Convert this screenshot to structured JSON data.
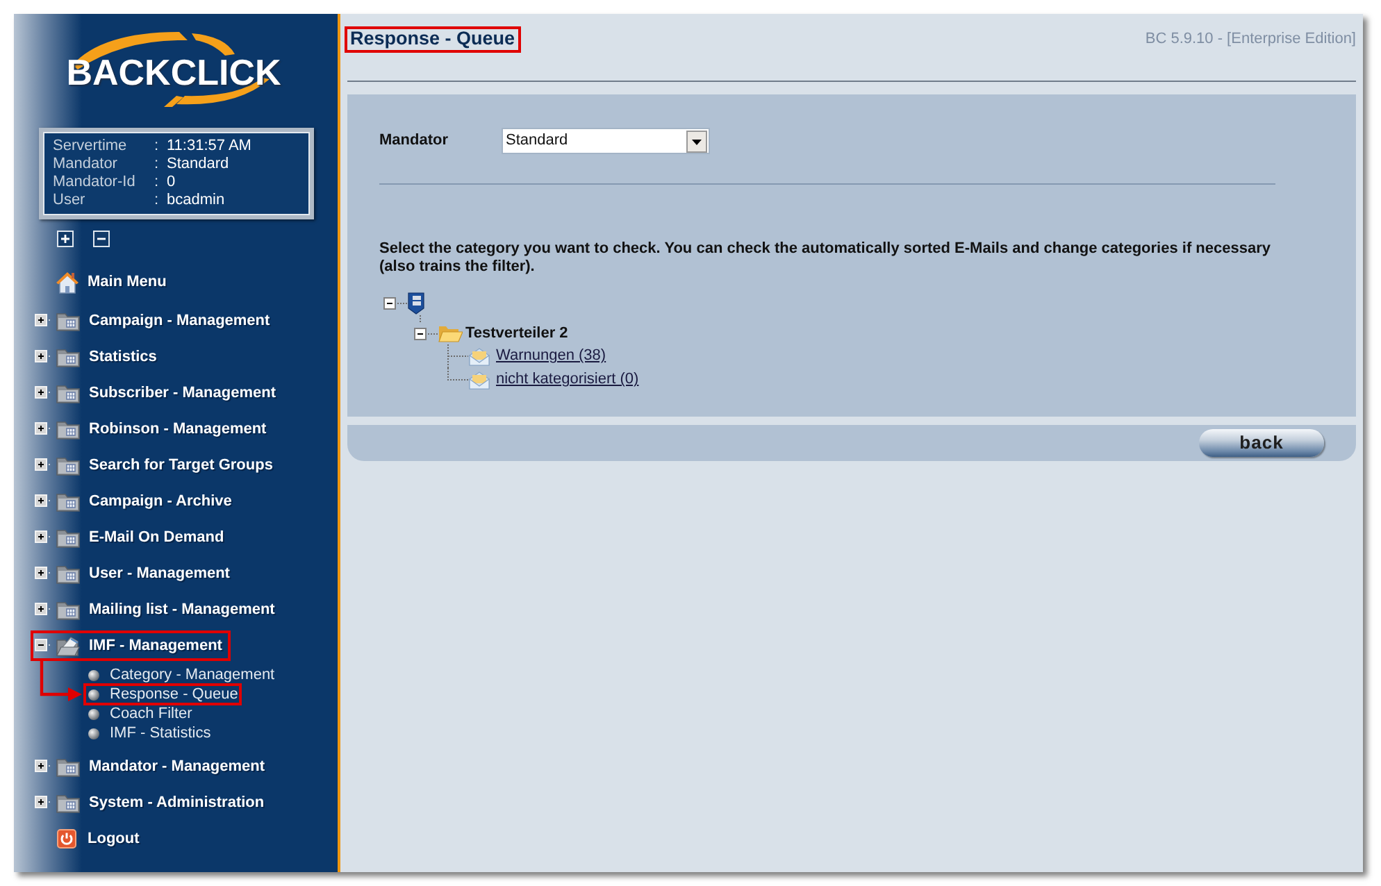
{
  "sidebar": {
    "logo": "BACKCLICK",
    "server_info": [
      {
        "label": "Servertime",
        "separator": ":",
        "value": "11:31:57 AM"
      },
      {
        "label": "Mandator",
        "separator": ":",
        "value": "Standard"
      },
      {
        "label": "Mandator-Id",
        "separator": ":",
        "value": "0"
      },
      {
        "label": "User",
        "separator": ":",
        "value": "bcadmin"
      }
    ],
    "menu": [
      {
        "kind": "home",
        "label": "Main Menu",
        "highlighted": false
      },
      {
        "kind": "folder",
        "label": "Campaign - Management",
        "expanded": false,
        "highlighted": false
      },
      {
        "kind": "folder",
        "label": "Statistics",
        "expanded": false,
        "highlighted": false
      },
      {
        "kind": "folder",
        "label": "Subscriber - Management",
        "expanded": false,
        "highlighted": false
      },
      {
        "kind": "folder",
        "label": "Robinson - Management",
        "expanded": false,
        "highlighted": false
      },
      {
        "kind": "folder",
        "label": "Search for Target Groups",
        "expanded": false,
        "highlighted": false
      },
      {
        "kind": "folder",
        "label": "Campaign - Archive",
        "expanded": false,
        "highlighted": false
      },
      {
        "kind": "folder",
        "label": "E-Mail On Demand",
        "expanded": false,
        "highlighted": false
      },
      {
        "kind": "folder",
        "label": "User - Management",
        "expanded": false,
        "highlighted": false
      },
      {
        "kind": "folder",
        "label": "Mailing list - Management",
        "expanded": false,
        "highlighted": false
      },
      {
        "kind": "folder",
        "label": "IMF - Management",
        "expanded": true,
        "highlighted": true,
        "children": [
          {
            "label": "Category - Management",
            "highlighted": false
          },
          {
            "label": "Response - Queue",
            "highlighted": true
          },
          {
            "label": "Coach Filter",
            "highlighted": false
          },
          {
            "label": "IMF - Statistics",
            "highlighted": false
          }
        ]
      },
      {
        "kind": "folder",
        "label": "Mandator - Management",
        "expanded": false,
        "highlighted": false
      },
      {
        "kind": "folder",
        "label": "System - Administration",
        "expanded": false,
        "highlighted": false
      },
      {
        "kind": "logout",
        "label": "Logout",
        "highlighted": false
      }
    ]
  },
  "header": {
    "title": "Response - Queue",
    "highlighted": true,
    "version": "BC 5.9.10 - [Enterprise Edition]"
  },
  "form": {
    "mandator": {
      "label": "Mandator",
      "value": "Standard"
    }
  },
  "instructions": "Select the category you want to check. You can check the automatically sorted E-Mails and change categories if necessary (also trains the filter).",
  "category_tree": {
    "expanded": true,
    "children": [
      {
        "label": "Testverteiler 2",
        "expanded": true,
        "children": [
          {
            "label": "Warnungen (38)"
          },
          {
            "label": "nicht kategorisiert (0)"
          }
        ]
      }
    ]
  },
  "buttons": [
    {
      "label": "back"
    }
  ]
}
